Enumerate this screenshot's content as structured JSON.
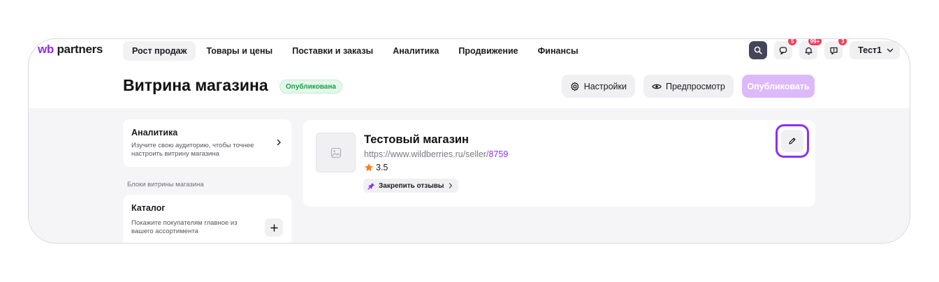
{
  "logo": {
    "wb": "wb",
    "partners": "partners"
  },
  "nav": {
    "items": [
      {
        "label": "Рост продаж",
        "active": true
      },
      {
        "label": "Товары и цены"
      },
      {
        "label": "Поставки и заказы"
      },
      {
        "label": "Аналитика"
      },
      {
        "label": "Продвижение"
      },
      {
        "label": "Финансы"
      }
    ]
  },
  "toolbar": {
    "search_icon": "search-icon",
    "chat_badge": "5",
    "notifications_badge": "99+",
    "support_badge": "3",
    "user_name": "Тест1"
  },
  "header": {
    "title": "Витрина магазина",
    "status": "Опубликована",
    "settings_label": "Настройки",
    "preview_label": "Предпросмотр",
    "publish_label": "Опубликовать"
  },
  "sidebar": {
    "analytics": {
      "title": "Аналитика",
      "description": "Изучите свою аудиторию, чтобы точнее настроить витрину магазина"
    },
    "section_label": "Блоки витрины магазина",
    "catalog": {
      "title": "Каталог",
      "description": "Покажите покупателям главное из вашего ассортимента"
    }
  },
  "store": {
    "name": "Тестовый магазин",
    "url_prefix": "https://www.wildberries.ru/seller/",
    "seller_id": "8759",
    "rating": "3.5",
    "pin_reviews_label": "Закрепить отзывы"
  },
  "colors": {
    "accent": "#8b2ff5",
    "badge": "#f43c5a",
    "status_text": "#1f9b4a",
    "publish_disabled": "#dcbaf9",
    "star": "#f7821b"
  }
}
